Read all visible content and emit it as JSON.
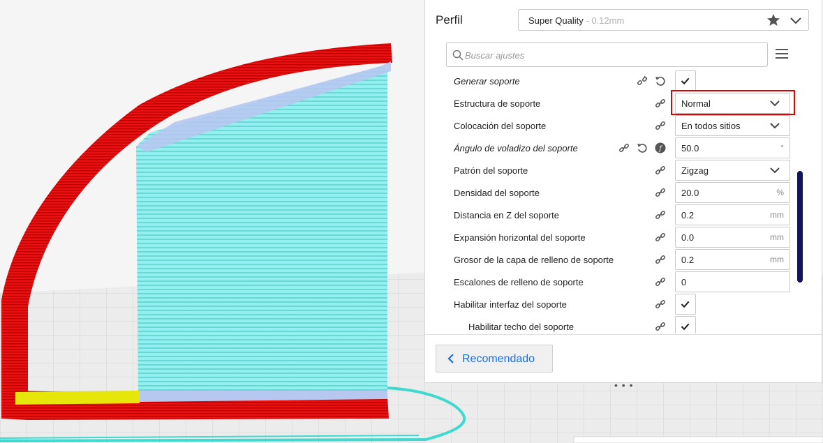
{
  "profile": {
    "label": "Perfil",
    "name": "Super Quality",
    "quality": " - 0.12mm"
  },
  "search": {
    "placeholder": "Buscar ajustes"
  },
  "settings": [
    {
      "label": "Generar soporte",
      "italic": true,
      "type": "check",
      "checked": true,
      "icons": [
        "link-broken-icon",
        "reset-icon"
      ]
    },
    {
      "label": "Estructura de soporte",
      "type": "select",
      "value": "Normal",
      "highlight": true
    },
    {
      "label": "Colocación del soporte",
      "type": "select",
      "value": "En todos sitios"
    },
    {
      "label": "Ángulo de voladizo del soporte",
      "italic": true,
      "type": "number",
      "value": "50.0",
      "unit": "°",
      "icons": [
        "link-icon",
        "reset-icon",
        "function-icon"
      ]
    },
    {
      "label": "Patrón del soporte",
      "type": "select",
      "value": "Zigzag"
    },
    {
      "label": "Densidad del soporte",
      "type": "number",
      "value": "20.0",
      "unit": "%"
    },
    {
      "label": "Distancia en Z del soporte",
      "type": "number",
      "value": "0.2",
      "unit": "mm"
    },
    {
      "label": "Expansión horizontal del soporte",
      "type": "number",
      "value": "0.0",
      "unit": "mm"
    },
    {
      "label": "Grosor de la capa de relleno de soporte",
      "type": "number",
      "value": "0.2",
      "unit": "mm"
    },
    {
      "label": "Escalones de relleno de soporte",
      "type": "number",
      "value": "0",
      "unit": ""
    },
    {
      "label": "Habilitar interfaz del soporte",
      "type": "check",
      "checked": true
    },
    {
      "label": "Habilitar techo del soporte",
      "type": "check",
      "checked": true,
      "indent": true
    }
  ],
  "footer": {
    "recommended_label": "Recomendado",
    "drag_handle": "• • •"
  },
  "colors": {
    "accent": "#196ef0",
    "highlight": "#e00000",
    "scrollbar": "#14145a",
    "model_red": "#e00000",
    "support_cyan": "#8ff0ee"
  }
}
